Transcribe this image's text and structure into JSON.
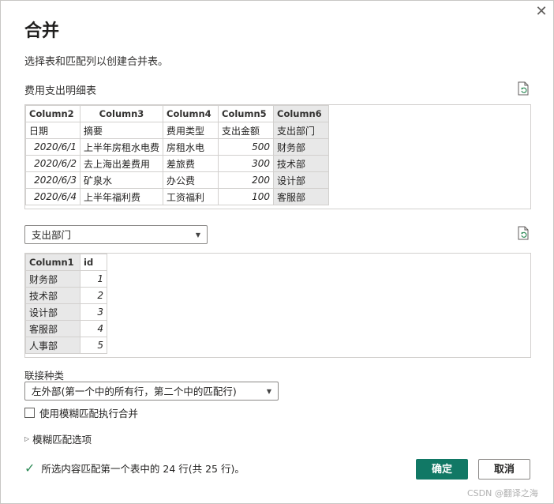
{
  "dialog": {
    "title": "合并",
    "description": "选择表和匹配列以创建合并表。"
  },
  "table1": {
    "label": "费用支出明细表",
    "columns": [
      "Column2",
      "Column3",
      "Column4",
      "Column5",
      "Column6"
    ],
    "rows": [
      [
        "日期",
        "摘要",
        "费用类型",
        "支出金额",
        "支出部门"
      ],
      [
        "2020/6/1",
        "上半年房租水电费",
        "房租水电",
        "500",
        "财务部"
      ],
      [
        "2020/6/2",
        "去上海出差费用",
        "差旅费",
        "300",
        "技术部"
      ],
      [
        "2020/6/3",
        "矿泉水",
        "办公费",
        "200",
        "设计部"
      ],
      [
        "2020/6/4",
        "上半年福利费",
        "工资福利",
        "100",
        "客服部"
      ]
    ]
  },
  "table2": {
    "selected_table": "支出部门",
    "columns": [
      "Column1",
      "id"
    ],
    "rows": [
      [
        "财务部",
        "1"
      ],
      [
        "技术部",
        "2"
      ],
      [
        "设计部",
        "3"
      ],
      [
        "客服部",
        "4"
      ],
      [
        "人事部",
        "5"
      ]
    ]
  },
  "join": {
    "label": "联接种类",
    "selected": "左外部(第一个中的所有行，第二个中的匹配行)"
  },
  "fuzzy_checkbox_label": "使用模糊匹配执行合并",
  "fuzzy_options_label": "模糊匹配选项",
  "status_text": "所选内容匹配第一个表中的 24 行(共 25 行)。",
  "buttons": {
    "ok": "确定",
    "cancel": "取消"
  },
  "watermark": "CSDN @翻译之海",
  "colors": {
    "primary": "#117865",
    "selected_column": "#e8e8e8",
    "success": "#2e8b57"
  },
  "icons": {
    "close": "close-icon",
    "refresh": "refresh-icon",
    "check": "check-icon",
    "caret": "chevron-down-icon",
    "expand": "expand-triangle-icon"
  }
}
